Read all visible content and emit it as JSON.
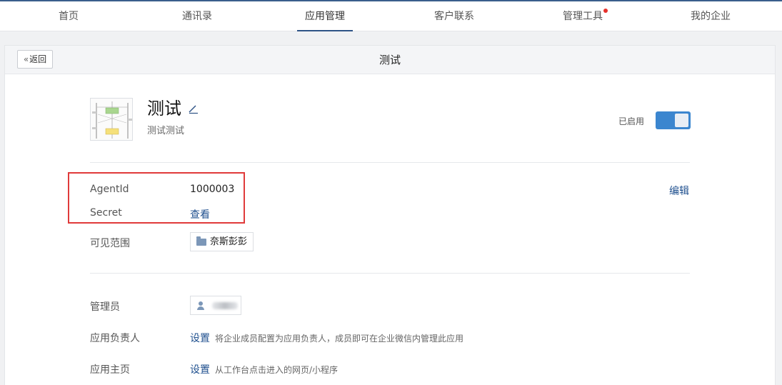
{
  "nav": {
    "items": [
      {
        "label": "首页"
      },
      {
        "label": "通讯录"
      },
      {
        "label": "应用管理"
      },
      {
        "label": "客户联系"
      },
      {
        "label": "管理工具"
      },
      {
        "label": "我的企业"
      }
    ],
    "active_index": 2,
    "notification_dot_color": "#e6312c"
  },
  "header": {
    "back_label": "返回",
    "title": "测试"
  },
  "app": {
    "name": "测试",
    "description": "测试测试",
    "enabled_label": "已启用",
    "enabled": true
  },
  "credentials": {
    "agentid_label": "AgentId",
    "agentid_value": "1000003",
    "secret_label": "Secret",
    "secret_link": "查看",
    "edit_label": "编辑"
  },
  "visibility": {
    "label": "可见范围",
    "value": "奈斯彭彭"
  },
  "settings": {
    "admin_label": "管理员",
    "owner_label": "应用负责人",
    "owner_action": "设置",
    "owner_hint": "将企业成员配置为应用负责人，成员即可在企业微信内管理此应用",
    "homepage_label": "应用主页",
    "homepage_action": "设置",
    "homepage_hint": "从工作台点击进入的网页/小程序"
  },
  "colors": {
    "accent": "#2e5386",
    "toggle": "#3b86cf",
    "highlight": "#e03a3a"
  }
}
